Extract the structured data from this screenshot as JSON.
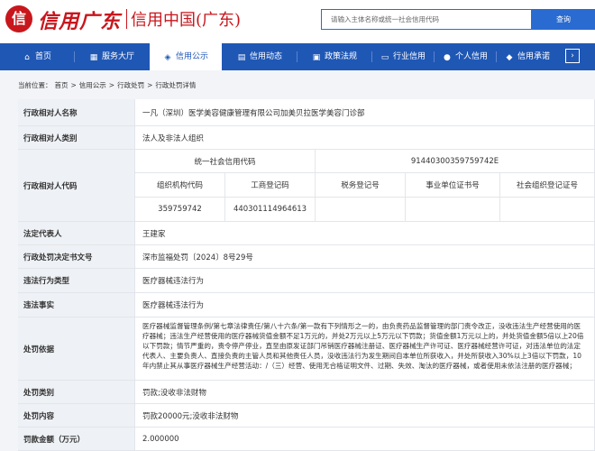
{
  "header": {
    "logo_mark": "信",
    "logo_script": "信用广东",
    "logo_text": "信用中国(广东)",
    "search_placeholder": "请输入主体名称或统一社会信用代码",
    "search_button": "查询"
  },
  "nav": {
    "items": [
      {
        "label": "首页",
        "icon": "home-icon"
      },
      {
        "label": "服务大厅",
        "icon": "grid-icon"
      },
      {
        "label": "信用公示",
        "icon": "megaphone-icon"
      },
      {
        "label": "信用动态",
        "icon": "document-icon"
      },
      {
        "label": "政策法规",
        "icon": "book-icon"
      },
      {
        "label": "行业信用",
        "icon": "computer-icon"
      },
      {
        "label": "个人信用",
        "icon": "person-icon"
      },
      {
        "label": "信用承诺",
        "icon": "shield-icon"
      }
    ],
    "active_index": 2,
    "more_icon": "chevron-right-icon"
  },
  "breadcrumb": {
    "prefix": "当前位置：",
    "items": [
      "首页",
      "信用公示",
      "行政处罚",
      "行政处罚详情"
    ],
    "separator": ">"
  },
  "detail": {
    "party_name_label": "行政相对人名称",
    "party_name": "一凡（深圳）医学美容健康管理有限公司加美贝拉医学美容门诊部",
    "party_type_label": "行政相对人类别",
    "party_type": "法人及非法人组织",
    "party_code_label": "行政相对人代码",
    "uscc_label": "统一社会信用代码",
    "uscc": "91440300359759742E",
    "code_headers": [
      "组织机构代码",
      "工商登记码",
      "税务登记号",
      "事业单位证书号",
      "社会组织登记证号"
    ],
    "code_values": [
      "359759742",
      "440301114964613",
      "",
      "",
      ""
    ],
    "legal_rep_label": "法定代表人",
    "legal_rep": "王建家",
    "doc_no_label": "行政处罚决定书文号",
    "doc_no": "深市监福处罚〔2024〕8号29号",
    "violation_type_label": "违法行为类型",
    "violation_type": "医疗器械违法行为",
    "violation_fact_label": "违法事实",
    "violation_fact": "医疗器械违法行为",
    "basis_label": "处罚依据",
    "basis": "医疗器械监督管理条例/第七章法律责任/第八十六条/第一款有下列情形之一的，由负责药品监督管理的部门责令改正，没收违法生产经营使用的医疗器械；违法生产经营使用的医疗器械货值金额不足1万元的，并处2万元以上5万元以下罚款；货值金额1万元以上的，并处货值金额5倍以上20倍以下罚款；情节严重的，责令停产停业，直至由原发证部门吊销医疗器械注册证、医疗器械生产许可证、医疗器械经营许可证，对违法单位的法定代表人、主要负责人、直接负责的主管人员和其他责任人员，没收违法行为发生期间自本单位所获收入，并处所获收入30%以上3倍以下罚款，10年内禁止其从事医疗器械生产经营活动：/（三）经营、使用无合格证明文件、过期、失效、淘汰的医疗器械，或者使用未依法注册的医疗器械；",
    "penalty_type_label": "处罚类别",
    "penalty_type": "罚款;没收非法财物",
    "penalty_content_label": "处罚内容",
    "penalty_content": "罚款20000元;没收非法财物",
    "fine_label": "罚款金额（万元）",
    "fine": "2.000000"
  }
}
